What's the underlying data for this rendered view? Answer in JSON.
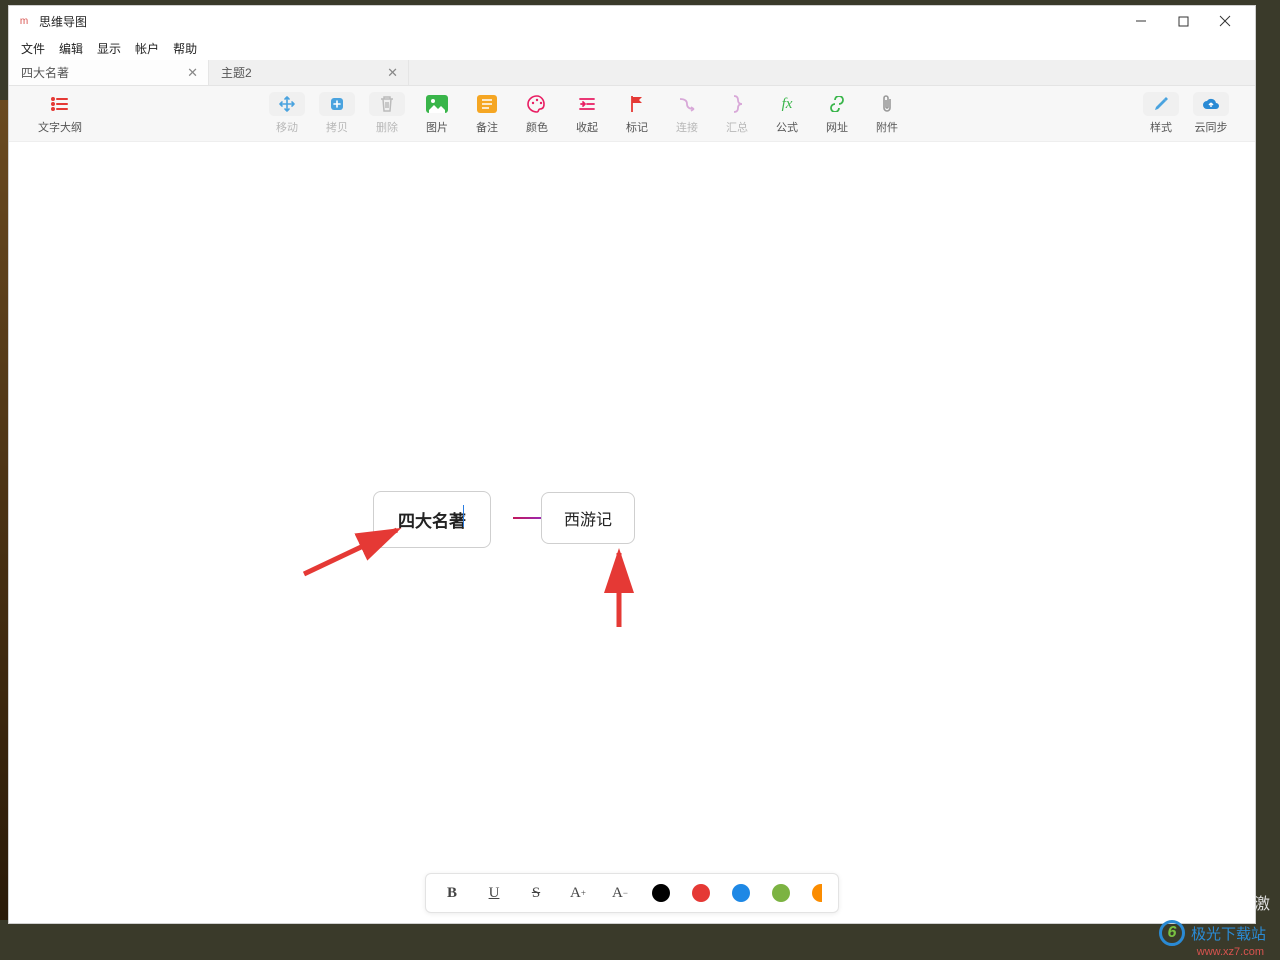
{
  "app": {
    "title": "思维导图"
  },
  "menu": {
    "file": "文件",
    "edit": "编辑",
    "view": "显示",
    "account": "帐户",
    "help": "帮助"
  },
  "tabs": [
    {
      "label": "四大名著",
      "active": true
    },
    {
      "label": "主题2",
      "active": false
    }
  ],
  "toolbar": {
    "outline": "文字大纲",
    "move": "移动",
    "copy": "拷贝",
    "delete": "删除",
    "image": "图片",
    "note": "备注",
    "color": "颜色",
    "collapse": "收起",
    "mark": "标记",
    "link": "连接",
    "summary": "汇总",
    "formula": "公式",
    "url": "网址",
    "attach": "附件",
    "style": "样式",
    "cloud": "云同步"
  },
  "mindmap": {
    "central": "四大名著",
    "child1": "西游记"
  },
  "format": {
    "bold": "B",
    "underline": "U",
    "strike": "S",
    "increase": "A",
    "decrease": "A"
  },
  "colors": {
    "black": "#000000",
    "red": "#e53935",
    "blue": "#1e88e5",
    "green": "#7cb342",
    "orange": "#fb8c00"
  },
  "watermark": {
    "brand": "极光下载站",
    "url": "www.xz7.com",
    "activate": "激"
  }
}
